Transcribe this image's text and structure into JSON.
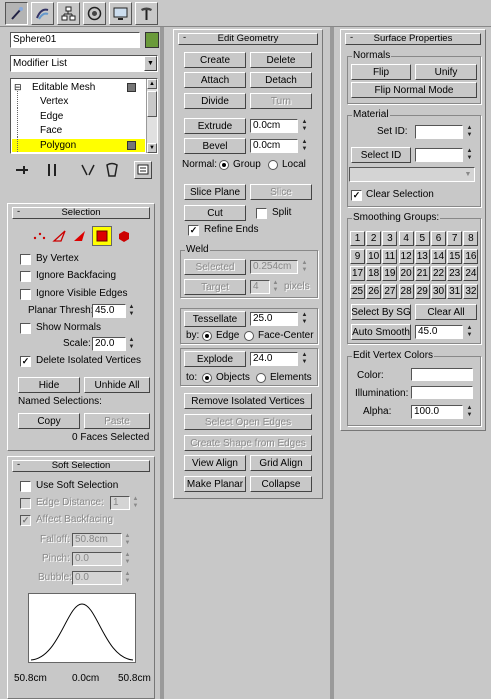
{
  "toolbar": {
    "tabs": [
      "create-icon",
      "modify-icon",
      "hierarchy-icon",
      "motion-icon",
      "display-icon",
      "utilities-icon"
    ]
  },
  "object": {
    "name": "Sphere01",
    "color": "#6a9a3a"
  },
  "modifier_list": {
    "label": "Modifier List",
    "arrow": "▼"
  },
  "stack": {
    "items": [
      {
        "label": "Editable Mesh",
        "sign": "⊟",
        "box": true,
        "selected": false
      },
      {
        "label": "Vertex",
        "sign": "",
        "box": false,
        "selected": false
      },
      {
        "label": "Edge",
        "sign": "",
        "box": false,
        "selected": false
      },
      {
        "label": "Face",
        "sign": "",
        "box": false,
        "selected": false
      },
      {
        "label": "Polygon",
        "sign": "",
        "box": true,
        "selected": true
      }
    ]
  },
  "colors": {
    "selected": "#ffff00",
    "highlight": "#e00000"
  },
  "selection": {
    "title": "Selection",
    "minus": "-",
    "by_vertex": "By Vertex",
    "ignore_backfacing": "Ignore Backfacing",
    "ignore_visible_edges": "Ignore Visible Edges",
    "planar_thresh_label": "Planar Thresh:",
    "planar_thresh_value": "45.0",
    "show_normals": "Show Normals",
    "scale_label": "Scale:",
    "scale_value": "20.0",
    "delete_isolated": "Delete Isolated Vertices",
    "delete_isolated_check": "✓",
    "hide": "Hide",
    "unhide_all": "Unhide All",
    "named_selections": "Named Selections:",
    "copy": "Copy",
    "paste": "Paste",
    "status": "0 Faces Selected"
  },
  "soft": {
    "title": "Soft Selection",
    "minus": "-",
    "use_soft": "Use Soft Selection",
    "edge_distance": "Edge Distance:",
    "edge_distance_value": "1",
    "affect_backfacing": "Affect Backfacing",
    "affect_check": "✓",
    "falloff_label": "Falloff:",
    "falloff_value": "50.8cm",
    "pinch_label": "Pinch:",
    "pinch_value": "0.0",
    "bubble_label": "Bubble:",
    "bubble_value": "0.0",
    "graph_left": "50.8cm",
    "graph_center": "0.0cm",
    "graph_right": "50.8cm"
  },
  "edit": {
    "title": "Edit Geometry",
    "minus": "-",
    "create": "Create",
    "delete": "Delete",
    "attach": "Attach",
    "detach": "Detach",
    "divide": "Divide",
    "turn": "Turn",
    "extrude": "Extrude",
    "extrude_value": "0.0cm",
    "bevel": "Bevel",
    "bevel_value": "0.0cm",
    "normal_label": "Normal:",
    "group": "Group",
    "local": "Local",
    "slice_plane": "Slice Plane",
    "slice": "Slice",
    "cut": "Cut",
    "split": "Split",
    "refine_ends": "Refine Ends",
    "refine_check": "✓",
    "weld_label": "Weld",
    "selected": "Selected",
    "selected_value": "0.254cm",
    "target": "Target",
    "target_value": "4",
    "pixels": "pixels",
    "tessellate": "Tessellate",
    "tess_value": "25.0",
    "by_label": "by:",
    "edge": "Edge",
    "face_center": "Face-Center",
    "explode": "Explode",
    "explode_value": "24.0",
    "to_label": "to:",
    "objects": "Objects",
    "elements": "Elements",
    "remove_isolated": "Remove Isolated Vertices",
    "select_open_edges": "Select Open Edges",
    "create_shape": "Create Shape from Edges",
    "view_align": "View Align",
    "grid_align": "Grid Align",
    "make_planar": "Make Planar",
    "collapse": "Collapse"
  },
  "surface": {
    "title": "Surface Properties",
    "minus": "-",
    "normals_label": "Normals",
    "flip": "Flip",
    "unify": "Unify",
    "flip_normal_mode": "Flip Normal Mode",
    "material_label": "Material",
    "set_id": "Set ID:",
    "select_id": "Select ID",
    "clear_selection": "Clear Selection",
    "clear_check": "✓",
    "smoothing_label": "Smoothing Groups:",
    "groups": [
      "1",
      "2",
      "3",
      "4",
      "5",
      "6",
      "7",
      "8",
      "9",
      "10",
      "11",
      "12",
      "13",
      "14",
      "15",
      "16",
      "17",
      "18",
      "19",
      "20",
      "21",
      "22",
      "23",
      "24",
      "25",
      "26",
      "27",
      "28",
      "29",
      "30",
      "31",
      "32"
    ],
    "select_by_sg": "Select By SG",
    "clear_all": "Clear All",
    "auto_smooth": "Auto Smooth",
    "auto_smooth_value": "45.0",
    "vertex_colors_label": "Edit Vertex Colors",
    "color_label": "Color:",
    "illumination_label": "Illumination:",
    "alpha_label": "Alpha:",
    "alpha_value": "100.0"
  }
}
